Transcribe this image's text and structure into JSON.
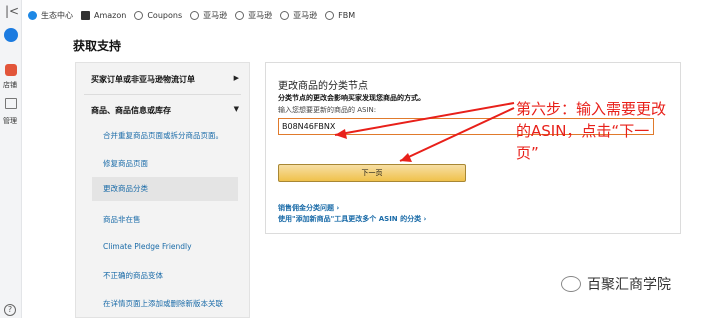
{
  "bookmarks": [
    {
      "label": "生态中心",
      "icon": "blue-app-icon"
    },
    {
      "label": "Amazon",
      "icon": "amazon-icon"
    },
    {
      "label": "Coupons",
      "icon": "globe-icon"
    },
    {
      "label": "亚马逊",
      "icon": "globe-icon"
    },
    {
      "label": "亚马逊",
      "icon": "globe-icon"
    },
    {
      "label": "亚马逊",
      "icon": "globe-icon"
    },
    {
      "label": "FBM",
      "icon": "globe-icon"
    }
  ],
  "rail": {
    "shop_label": "店铺",
    "manage_label": "管理",
    "help": "?"
  },
  "page_title": "获取支持",
  "menu": {
    "section1": "买家订单或非亚马逊物流订单",
    "section2": "商品、商品信息或库存",
    "items": [
      "合并重复商品页面或拆分商品页面。",
      "修复商品页面",
      "更改商品分类",
      "商品非在售",
      "Climate Pledge Friendly",
      "不正确的商品变体",
      "在详情页面上添加或删除新版本关联"
    ],
    "active_index": 2
  },
  "card": {
    "heading": "更改商品的分类节点",
    "subtitle": "分类节点的更改会影响买家发现您商品的方式。",
    "input_label": "输入您想要更新的商品的 ASIN:",
    "asin_value": "B08N46FBNX",
    "next_button": "下一页",
    "link1": "销售佣金分类问题 ›",
    "link2": "使用\"添加新商品\"工具更改多个 ASIN 的分类 ›"
  },
  "annotation": {
    "line1": "第六步：输入需要更改",
    "line2": "的ASIN，点击“下一",
    "line3": "页”",
    "color": "#e8201a"
  },
  "watermark": "百聚汇商学院"
}
